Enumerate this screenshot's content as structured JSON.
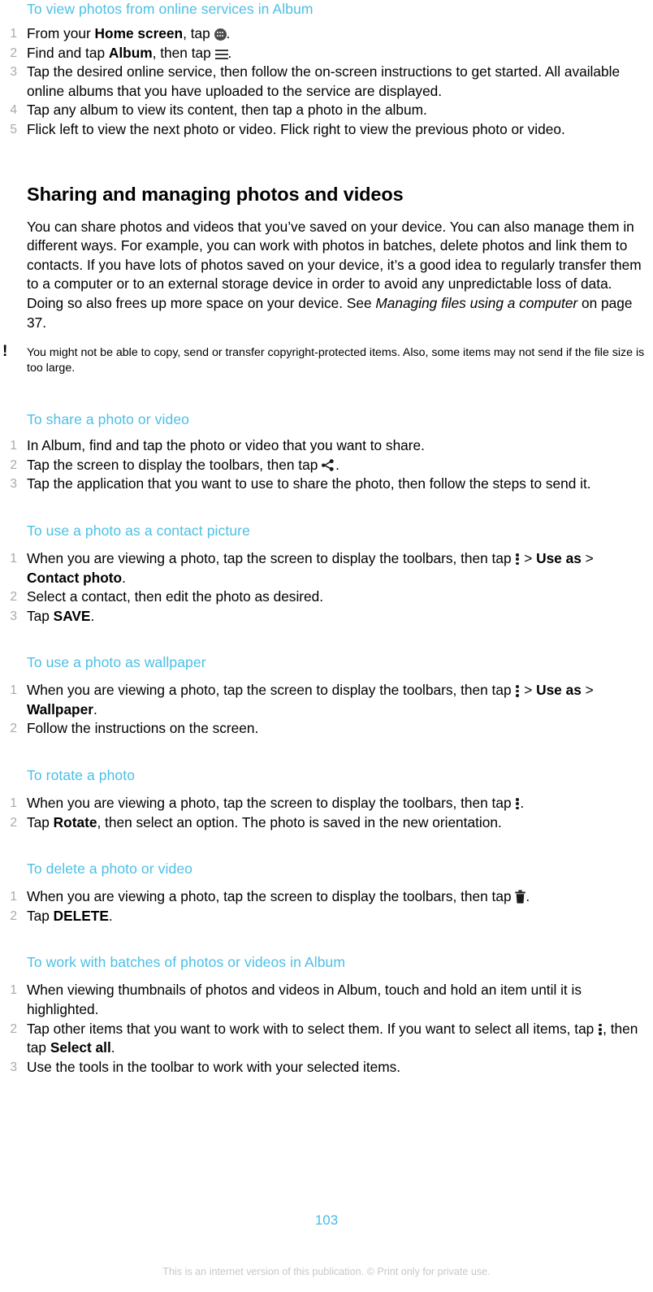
{
  "document": {
    "page_number": "103",
    "footer_note": "This is an internet version of this publication. © Print only for private use.",
    "accent_color": "#4cbfe6",
    "number_color": "#a9a9a9"
  },
  "section_online": {
    "heading": "To view photos from online services in Album",
    "steps": [
      {
        "num": "1",
        "pre": "From your ",
        "bold1": "Home screen",
        "mid": ", tap ",
        "icon": "app-drawer-icon",
        "post": "."
      },
      {
        "num": "2",
        "pre": "Find and tap ",
        "bold1": "Album",
        "mid": ", then tap ",
        "icon": "hamburger-menu-icon",
        "post": "."
      },
      {
        "num": "3",
        "text": "Tap the desired online service, then follow the on-screen instructions to get started. All available online albums that you have uploaded to the service are displayed."
      },
      {
        "num": "4",
        "text": "Tap any album to view its content, then tap a photo in the album."
      },
      {
        "num": "5",
        "text": "Flick left to view the next photo or video. Flick right to view the previous photo or video."
      }
    ]
  },
  "section_sharing": {
    "heading": "Sharing and managing photos and videos",
    "paragraph_part1": "You can share photos and videos that you’ve saved on your device. You can also manage them in different ways. For example, you can work with photos in batches, delete photos and link them to contacts. If you have lots of photos saved on your device, it’s a good idea to regularly transfer them to a computer or to an external storage device in order to avoid any unpredictable loss of data. Doing so also frees up more space on your device. See ",
    "paragraph_italic": "Managing files using a computer",
    "paragraph_part2": " on page 37.",
    "note_icon": "!",
    "note_text": "You might not be able to copy, send or transfer copyright-protected items. Also, some items may not send if the file size is too large."
  },
  "section_share": {
    "heading": "To share a photo or video",
    "steps": [
      {
        "num": "1",
        "text": "In Album, find and tap the photo or video that you want to share."
      },
      {
        "num": "2",
        "pre": "Tap the screen to display the toolbars, then tap ",
        "icon": "share-icon",
        "post": "."
      },
      {
        "num": "3",
        "text": "Tap the application that you want to use to share the photo, then follow the steps to send it."
      }
    ]
  },
  "section_contact": {
    "heading": "To use a photo as a contact picture",
    "steps": [
      {
        "num": "1",
        "pre": "When you are viewing a photo, tap the screen to display the toolbars, then tap ",
        "icon": "overflow-menu-icon",
        "sep1": " > ",
        "bold1": "Use as",
        "sep2": " > ",
        "bold2": "Contact photo",
        "post": "."
      },
      {
        "num": "2",
        "text": "Select a contact, then edit the photo as desired."
      },
      {
        "num": "3",
        "pre": "Tap ",
        "bold1": "SAVE",
        "post": "."
      }
    ]
  },
  "section_wallpaper": {
    "heading": "To use a photo as wallpaper",
    "steps": [
      {
        "num": "1",
        "pre": "When you are viewing a photo, tap the screen to display the toolbars, then tap ",
        "icon": "overflow-menu-icon",
        "sep1": " > ",
        "bold1": "Use as",
        "sep2": " > ",
        "bold2": "Wallpaper",
        "post": "."
      },
      {
        "num": "2",
        "text": "Follow the instructions on the screen."
      }
    ]
  },
  "section_rotate": {
    "heading": "To rotate a photo",
    "steps": [
      {
        "num": "1",
        "pre": "When you are viewing a photo, tap the screen to display the toolbars, then tap ",
        "icon": "overflow-menu-icon",
        "post": "."
      },
      {
        "num": "2",
        "pre": "Tap ",
        "bold1": "Rotate",
        "post": ", then select an option. The photo is saved in the new orientation."
      }
    ]
  },
  "section_delete": {
    "heading": "To delete a photo or video",
    "steps": [
      {
        "num": "1",
        "pre": "When you are viewing a photo, tap the screen to display the toolbars, then tap ",
        "icon": "trash-icon",
        "post": "."
      },
      {
        "num": "2",
        "pre": "Tap ",
        "bold1": "DELETE",
        "post": "."
      }
    ]
  },
  "section_batches": {
    "heading": "To work with batches of photos or videos in Album",
    "steps": [
      {
        "num": "1",
        "text": "When viewing thumbnails of photos and videos in Album, touch and hold an item until it is highlighted."
      },
      {
        "num": "2",
        "pre": "Tap other items that you want to work with to select them. If you want to select all items, tap ",
        "icon": "overflow-menu-icon",
        "mid": ", then tap ",
        "bold1": "Select all",
        "post": "."
      },
      {
        "num": "3",
        "text": "Use the tools in the toolbar to work with your selected items."
      }
    ]
  }
}
